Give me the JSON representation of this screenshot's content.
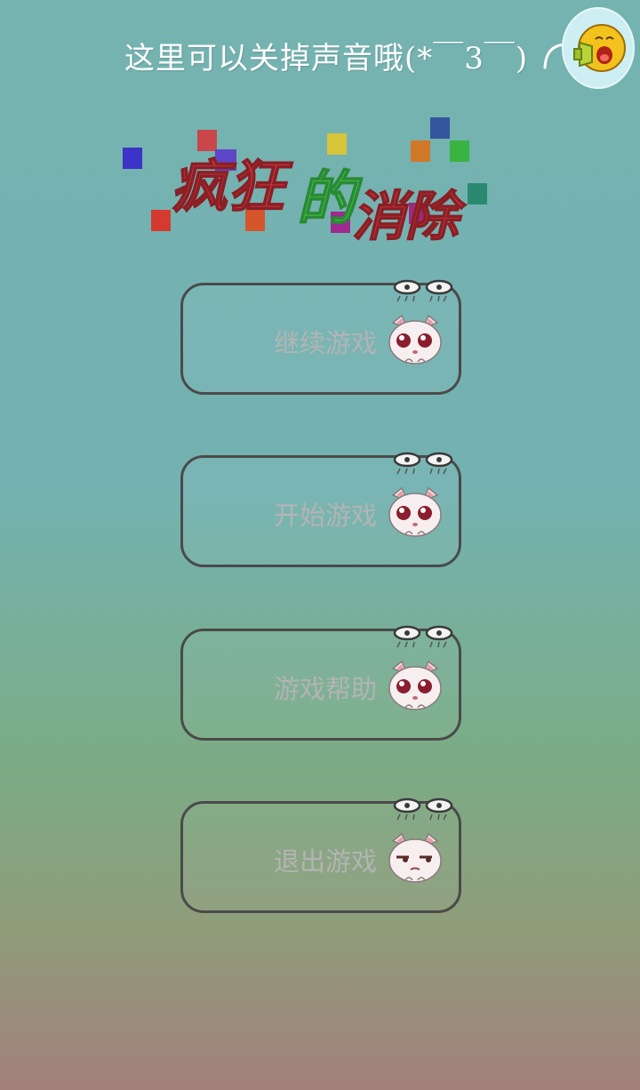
{
  "header": {
    "hint_text": "这里可以关掉声音哦(*￣3￣)",
    "sound_button_icon": "speaker-face-icon"
  },
  "title": {
    "part1": "疯狂",
    "part2": "的",
    "part3": "消除",
    "colors": {
      "part1": "#c4373f",
      "part2": "#44c04f",
      "part3": "#c4373f"
    }
  },
  "menu": {
    "items": [
      {
        "label": "继续游戏",
        "icon": "cat-face-icon"
      },
      {
        "label": "开始游戏",
        "icon": "cat-face-icon"
      },
      {
        "label": "游戏帮助",
        "icon": "cat-face-icon"
      },
      {
        "label": "退出游戏",
        "icon": "cat-face-sleepy-icon"
      }
    ]
  }
}
